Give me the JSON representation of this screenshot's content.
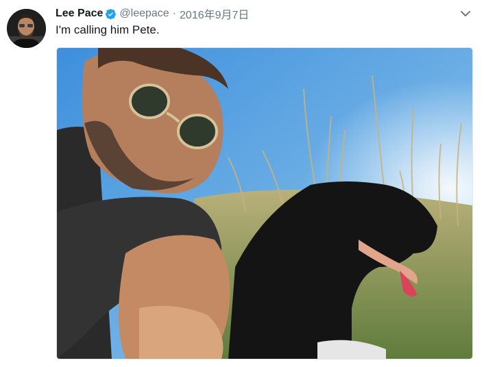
{
  "tweet": {
    "author_name": "Lee Pace",
    "handle": "@leepace",
    "separator": "·",
    "date": "2016年9月7日",
    "text": "I'm calling him Pete.",
    "verified": true,
    "media": {
      "subject": "photo-selfie-man-with-black-dog-in-grass"
    }
  },
  "icons": {
    "verified": "verified-badge-icon",
    "menu": "chevron-down-icon"
  },
  "colors": {
    "name": "#14171a",
    "meta": "#657786",
    "verified": "#1da1f2",
    "border": "#e1e8ed"
  }
}
